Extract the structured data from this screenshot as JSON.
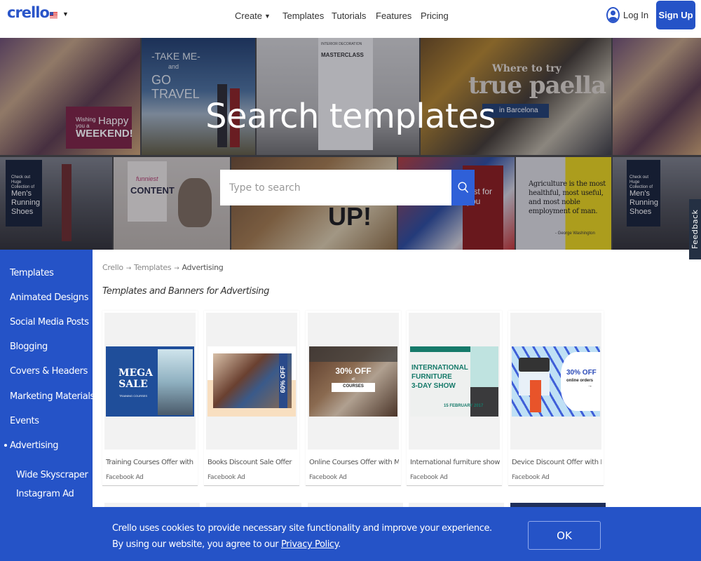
{
  "header": {
    "logo": "crello",
    "nav": [
      {
        "label": "Create",
        "has_caret": true
      },
      {
        "label": "Templates"
      },
      {
        "label": "Tutorials"
      },
      {
        "label": "Features"
      },
      {
        "label": "Pricing"
      }
    ],
    "login_label": "Log In",
    "signup_label": "Sign Up"
  },
  "hero": {
    "title": "Search templates",
    "search_placeholder": "Type to search",
    "search_value": "",
    "tiles": {
      "weekend_wish": "Wishing you a",
      "weekend_happy": "Happy",
      "weekend_main": "WEEKEND!",
      "travel_1": "-TAKE ME-",
      "travel_2": "and",
      "travel_3": "GO TRAVEL",
      "masterclass_head": "INTERIOR DECORATION",
      "masterclass_title": "MASTERCLASS",
      "paella_1": "Where to try",
      "paella_2": "true paella",
      "paella_3": "in Barcelona",
      "shoes_1": "Check out Huge Collection of",
      "shoes_2": "Men's Running Shoes",
      "content_1": "funniest",
      "content_2": "CONTENT",
      "up": "UP!",
      "ticket": "just for you",
      "quote": "Agriculture is the most healthful, most useful, and most noble employment of man.",
      "quote_author": "- George Washington"
    },
    "feedback_label": "Feedback"
  },
  "sidebar": {
    "items": [
      {
        "label": "Templates"
      },
      {
        "label": "Animated Designs"
      },
      {
        "label": "Social Media Posts"
      },
      {
        "label": "Blogging"
      },
      {
        "label": "Covers & Headers"
      },
      {
        "label": "Marketing Materials"
      },
      {
        "label": "Events"
      },
      {
        "label": "Advertising",
        "active": true
      }
    ],
    "subitems": [
      {
        "label": "Wide Skyscraper"
      },
      {
        "label": "Instagram Ad"
      }
    ]
  },
  "main": {
    "breadcrumb": [
      "Crello",
      "Templates",
      "Advertising"
    ],
    "title": "Templates and Banners for Advertising",
    "cards": [
      {
        "name": "Training Courses Offer with Sm...",
        "type": "Facebook Ad",
        "art_1": "MEGA",
        "art_2": "SALE",
        "art_3": "TRAINING COURSES"
      },
      {
        "name": "Books Discount Sale Offer",
        "type": "Facebook Ad",
        "art_1": "60% OFF"
      },
      {
        "name": "Online Courses Offer with Man...",
        "type": "Facebook Ad",
        "art_1": "30% OFF",
        "art_2": "all",
        "art_3": "COURSES"
      },
      {
        "name": "International furniture show",
        "type": "Facebook Ad",
        "art_1": "INTERNATIONAL",
        "art_2": "FURNITURE",
        "art_3": "3-DAY SHOW",
        "art_4": "15 FEBRUARY 2017"
      },
      {
        "name": "Device Discount Offer with La...",
        "type": "Facebook Ad",
        "art_1": "30% OFF",
        "art_2": "online orders"
      }
    ]
  },
  "cookie": {
    "line1": "Crello uses cookies to provide necessary site functionality and improve your experience.",
    "line2_prefix": "By using our website, you agree to our ",
    "link": "Privacy Policy",
    "line2_suffix": ".",
    "ok_label": "OK"
  },
  "colors": {
    "brand": "#2553c7",
    "search_button": "#2f60d8",
    "feedback": "#243043"
  }
}
